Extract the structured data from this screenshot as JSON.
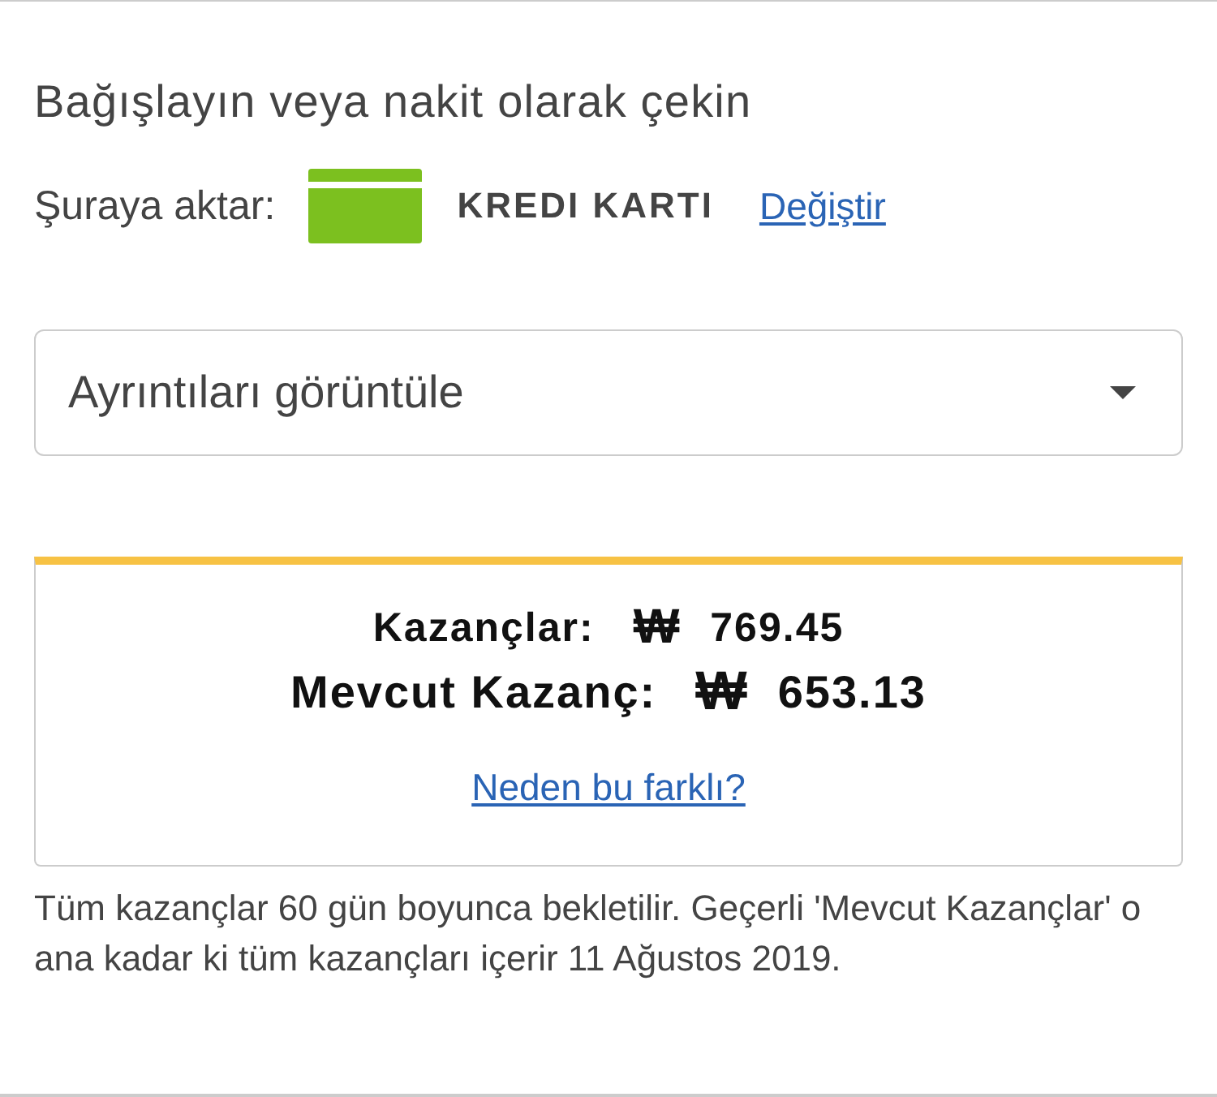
{
  "title": "Bağışlayın veya nakit olarak çekin",
  "transfer": {
    "label": "Şuraya aktar:",
    "method": "KREDI KARTI",
    "change_link": "Değiştir"
  },
  "details_dropdown": {
    "value": "Ayrıntıları görüntüle"
  },
  "earnings": {
    "rows": [
      {
        "kind": "small",
        "label": "Kazançlar:",
        "currency": "₩",
        "amount": "769.45"
      },
      {
        "kind": "large",
        "label": "Mevcut Kazanç:",
        "currency": "₩",
        "amount": "653.13"
      }
    ],
    "link": "Neden bu farklı?"
  },
  "note": "Tüm kazançlar 60 gün boyunca bekletilir. Geçerli 'Mevcut Kazançlar' o ana kadar ki tüm kazançları içerir 11 Ağustos 2019."
}
